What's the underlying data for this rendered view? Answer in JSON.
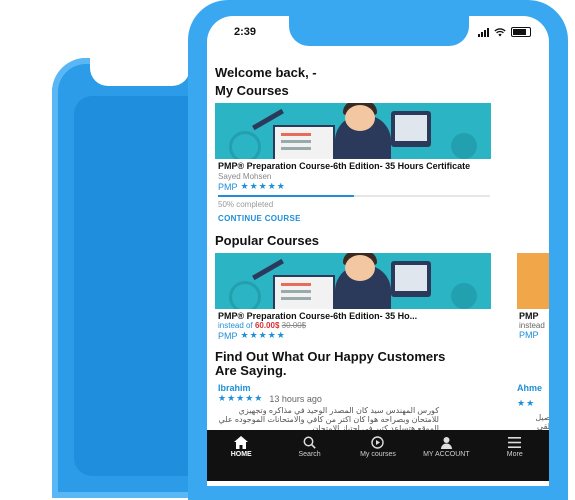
{
  "status_bar": {
    "time": "2:39"
  },
  "welcome": "Welcome back, -",
  "my_courses": {
    "title": "My Courses",
    "course": {
      "name": "PMP® Preparation Course-6th Edition-  35 Hours Certificate",
      "instructor": "Sayed Mohsen",
      "category": "PMP",
      "rating_stars": "★★★★★",
      "progress_percent": 50,
      "progress_label": "50% completed",
      "continue_label": "CONTINUE COURSE"
    }
  },
  "popular_courses": {
    "title": "Popular Courses",
    "course": {
      "name": "PMP® Preparation Course-6th Edition-  35 Ho...",
      "instead_label": "instead of",
      "price": "60.00$",
      "old_price": "30.00$",
      "category": "PMP",
      "rating_stars": "★★★★★"
    },
    "peek_course": {
      "name": "PMP",
      "instead_label": "instead",
      "category": "PMP"
    }
  },
  "testimonials": {
    "title": "Find Out What Our Happy Customers Are Saying.",
    "item": {
      "name": "Ibrahim",
      "stars": "★★★★★",
      "time": "13 hours ago",
      "text": "كورس المهندس سيد كان المصدر الوحيد في مذاكره وتجهيزي للامتحان وبصراحه هوا كان اكتر من كافي والامتحانات الموجوده علي الموقع هتساعد كتير في اجتياز الامتحان"
    },
    "peek": {
      "name": "Ahme",
      "stars": "★★",
      "text": "توصيل متلقى"
    }
  },
  "bottom_nav": [
    {
      "label": "HOME",
      "icon": "home-icon",
      "active": true
    },
    {
      "label": "Search",
      "icon": "search-icon",
      "active": false
    },
    {
      "label": "My courses",
      "icon": "play-circle-icon",
      "active": false
    },
    {
      "label": "MY ACCOUNT",
      "icon": "person-icon",
      "active": false
    },
    {
      "label": "More",
      "icon": "menu-icon",
      "active": false
    }
  ],
  "colors": {
    "accent": "#1e8fd8",
    "phone_frame": "#3aa8f0",
    "card_image_bg": "#2bb4c4",
    "price_red": "#d93030",
    "nav_bg": "#111111"
  }
}
